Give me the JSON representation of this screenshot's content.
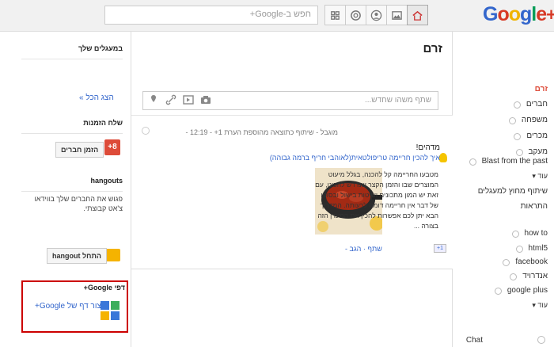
{
  "header": {
    "logo": {
      "g1": "G",
      "o1": "o",
      "o2": "o",
      "g2": "g",
      "l": "l",
      "e": "e",
      "plus": "+"
    },
    "search_placeholder": "חפש ב-Google+",
    "nav_icons": [
      "home-icon",
      "photos-icon",
      "profile-icon",
      "circles-icon",
      "games-icon"
    ]
  },
  "right_nav": {
    "items": [
      {
        "label": "זרם",
        "active": true
      },
      {
        "label": "חברים"
      },
      {
        "label": "משפחה"
      },
      {
        "label": "מכרים"
      },
      {
        "label": "מעקב"
      },
      {
        "label": "Blast from the past"
      },
      {
        "label": "עוד ▾"
      },
      {
        "label": "שיתוף מחוץ למעגלים"
      },
      {
        "label": "התראות"
      }
    ],
    "searches": [
      {
        "label": "how to"
      },
      {
        "label": "html5"
      },
      {
        "label": "facebook"
      },
      {
        "label": "אנדרויד"
      },
      {
        "label": "google plus"
      },
      {
        "label": "עוד ▾"
      }
    ],
    "chat_label": "Chat"
  },
  "main": {
    "title": "זרם",
    "share_placeholder": "שתף משהו שחדש...",
    "post": {
      "meta": "מוגבל - שיתוף כתוצאה מהוספת הערת 1+ - 12:19 -",
      "title": "מדהים!",
      "link_title": "איך להכין חריימה טריפולטאית(לאוהבי חריף ברמה גבוהה)",
      "description": "מטבעו החריימה קל להכנה, בגלל מיעוט המוצרים שבו והזמן הקצר שנדרש להכינו, עם זאת יש המון מתכונים ושיטות בישול ובסופו של דבר אין חריימה דומה לרעותה. המדריך הבא יתן לכם אפשרות להכין את המעדן הזה בצורה ...",
      "actions": "שתף · הגב -",
      "plus_one": "+1"
    }
  },
  "left_col": {
    "circles_title": "במעגלים שלך",
    "show_all": "הצג הכל »",
    "invite_title": "שלח הזמנות",
    "invite_button": "הזמן חברים",
    "hangouts_title": "hangouts",
    "hangouts_text": "פגוש את החברים שלך בווידאו צ'אט קבוצתי.",
    "hangout_button": "התחל hangout",
    "pages_title": "דפי Google+",
    "create_page": "צור דף של Google+"
  }
}
